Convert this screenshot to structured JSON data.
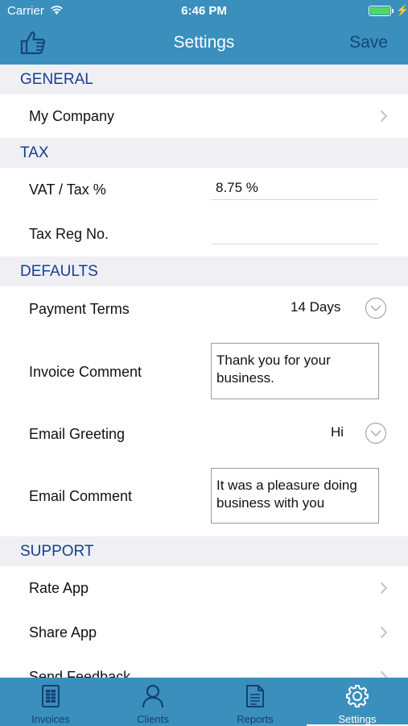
{
  "status": {
    "carrier": "Carrier",
    "time": "6:46 PM"
  },
  "nav": {
    "title": "Settings",
    "save_label": "Save"
  },
  "sections": {
    "general": {
      "header": "GENERAL",
      "my_company": "My Company"
    },
    "tax": {
      "header": "TAX",
      "vat_label": "VAT / Tax %",
      "vat_value": "8.75  %",
      "reg_label": "Tax Reg No.",
      "reg_value": ""
    },
    "defaults": {
      "header": "DEFAULTS",
      "payment_terms_label": "Payment Terms",
      "payment_terms_value": "14 Days",
      "invoice_comment_label": "Invoice Comment",
      "invoice_comment_value": "Thank you for your business.",
      "email_greeting_label": "Email Greeting",
      "email_greeting_value": "Hi",
      "email_comment_label": "Email Comment",
      "email_comment_value": "It was a pleasure doing business with you"
    },
    "support": {
      "header": "SUPPORT",
      "rate_app": "Rate App",
      "share_app": "Share App",
      "send_feedback": "Send Feedback"
    }
  },
  "tabs": [
    {
      "label": "Invoices",
      "icon": "invoice-icon"
    },
    {
      "label": "Clients",
      "icon": "person-icon"
    },
    {
      "label": "Reports",
      "icon": "report-icon"
    },
    {
      "label": "Settings",
      "icon": "gear-icon",
      "active": true
    }
  ],
  "colors": {
    "bar": "#3a8fbd",
    "section_header_text": "#173f8c",
    "save_text": "#15457a",
    "section_bg": "#efeff4"
  }
}
